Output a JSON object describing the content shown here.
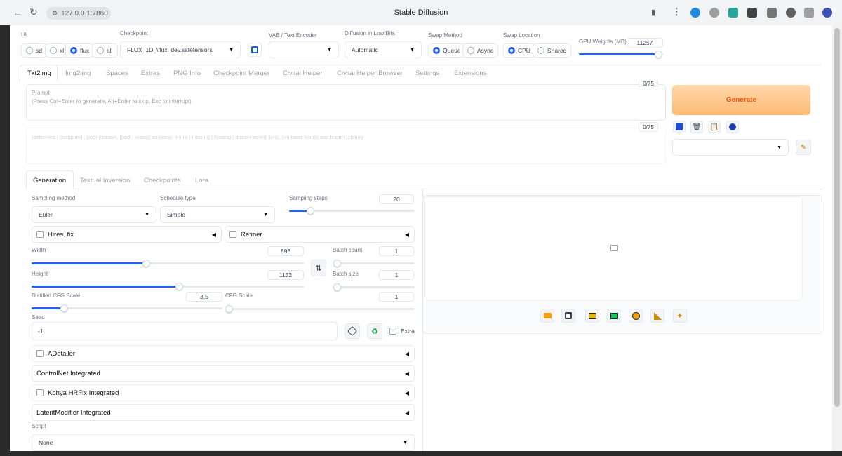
{
  "browser": {
    "url": "127.0.0.1:7860",
    "window_title": "Stable Diffusion"
  },
  "top": {
    "ui_label": "UI",
    "ui_options": [
      "sd",
      "xl",
      "flux",
      "all"
    ],
    "ui_selected": "flux",
    "checkpoint_label": "Checkpoint",
    "checkpoint_value": "FLUX_1D_\\flux_dev.safetensors",
    "vae_label": "VAE / Text Encoder",
    "vae_value": "",
    "diffusion_label": "Diffusion in Low Bits",
    "diffusion_value": "Automatic",
    "swap_method_label": "Swap Method",
    "swap_method_options": [
      "Queue",
      "Async"
    ],
    "swap_method_selected": "Queue",
    "swap_location_label": "Swap Location",
    "swap_location_options": [
      "CPU",
      "Shared"
    ],
    "swap_location_selected": "CPU",
    "gpu_weights_label": "GPU Weights (MB)",
    "gpu_weights_value": "11257",
    "gpu_weights_fraction": 0.94
  },
  "main_tabs": [
    "Txt2img",
    "Img2img",
    "Spaces",
    "Extras",
    "PNG Info",
    "Checkpoint Merger",
    "Civitai Helper",
    "Civitai Helper Browser",
    "Settings",
    "Extensions"
  ],
  "main_tab_active": "Txt2img",
  "prompt": {
    "label": "Prompt",
    "placeholder": "(Press Ctrl+Enter to generate, Alt+Enter to skip, Esc to interrupt)",
    "token_count": "0/75",
    "negative_placeholder": "[deformed | disfigured], poorly drawn, [bad : wrong] anatomy, [extra | missing | floating | disconnected] limb, (mutated hands and fingers), blurry",
    "negative_token_count": "0/75"
  },
  "generate_label": "Generate",
  "accent_color": "#f97316",
  "sub_tabs": [
    "Generation",
    "Textual Inversion",
    "Checkpoints",
    "Lora"
  ],
  "sub_tab_active": "Generation",
  "gen": {
    "sampling_method_label": "Sampling method",
    "sampling_method_value": "Euler",
    "schedule_type_label": "Schedule type",
    "schedule_type_value": "Simple",
    "sampling_steps_label": "Sampling steps",
    "sampling_steps_value": "20",
    "sampling_steps_fraction": 0.17,
    "hires_label": "Hires. fix",
    "refiner_label": "Refiner",
    "width_label": "Width",
    "width_value": "896",
    "width_fraction": 0.42,
    "height_label": "Height",
    "height_value": "1152",
    "height_fraction": 0.54,
    "batch_count_label": "Batch count",
    "batch_count_value": "1",
    "batch_size_label": "Batch size",
    "batch_size_value": "1",
    "distilled_cfg_label": "Distilled CFG Scale",
    "distilled_cfg_value": "3,5",
    "distilled_cfg_fraction": 0.17,
    "cfg_label": "CFG Scale",
    "cfg_value": "1",
    "seed_label": "Seed",
    "seed_value": "-1",
    "extra_label": "Extra",
    "accordions": [
      {
        "label": "ADetailer",
        "checkbox": true
      },
      {
        "label": "ControlNet Integrated",
        "checkbox": false
      },
      {
        "label": "Kohya HRFix Integrated",
        "checkbox": true
      },
      {
        "label": "LatentModifier Integrated",
        "checkbox": false
      }
    ],
    "script_label": "Script",
    "script_value": "None"
  }
}
